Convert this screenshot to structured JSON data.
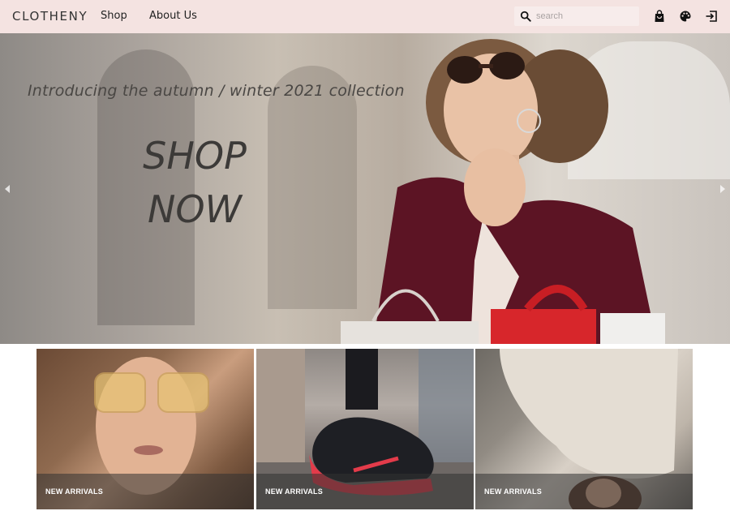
{
  "header": {
    "brand": "CLOTHENY",
    "nav": [
      {
        "label": "Shop"
      },
      {
        "label": "About Us"
      }
    ],
    "search": {
      "placeholder": "search",
      "value": ""
    },
    "icons": [
      "search-icon",
      "shopping-bag-icon",
      "palette-icon",
      "logout-icon"
    ],
    "background_color": "#f4e3e1"
  },
  "hero": {
    "tagline": "Introducing the autumn / winter  2021 collection",
    "cta_line1": "SHOP",
    "cta_line2": "NOW",
    "controls": [
      "chevron-left-icon",
      "chevron-right-icon"
    ]
  },
  "cards": [
    {
      "label": "NEW ARRIVALS"
    },
    {
      "label": "NEW ARRIVALS"
    },
    {
      "label": "NEW ARRIVALS"
    }
  ]
}
